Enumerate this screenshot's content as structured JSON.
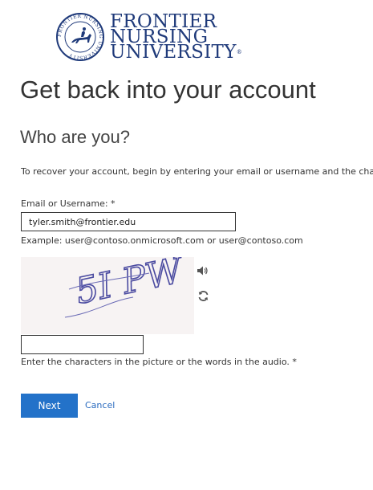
{
  "logo": {
    "line1": "FRONTIER",
    "line2": "NURSING",
    "line3": "UNIVERSITY",
    "mark": "®",
    "seal_text": "FRONTIER NURSING UNIVERSITY",
    "brand_color": "#1f3a7a"
  },
  "heading": "Get back into your account",
  "subheading": "Who are you?",
  "intro": "To recover your account, begin by entering your email or username and the characters in the picture or audio below.",
  "form": {
    "email_label": "Email or Username: *",
    "email_value": "tyler.smith@frontier.edu",
    "example": "Example: user@contoso.onmicrosoft.com or user@contoso.com",
    "captcha_text": "5I PW",
    "audio_icon": "speaker-icon",
    "refresh_icon": "refresh-icon",
    "captcha_value": "",
    "captcha_hint": "Enter the characters in the picture or the words in the audio. *"
  },
  "actions": {
    "next_label": "Next",
    "cancel_label": "Cancel",
    "accent_color": "#2372c9"
  }
}
